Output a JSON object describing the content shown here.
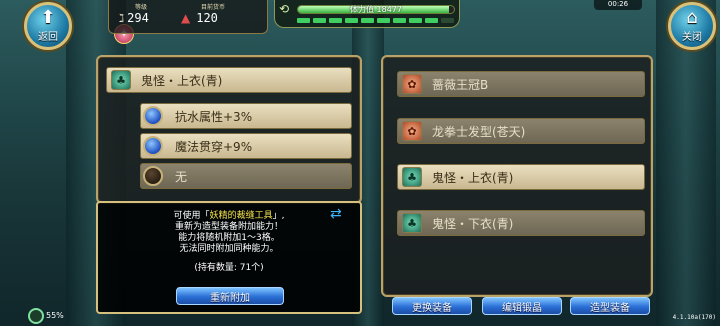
{
  "hud": {
    "back_label": "返回",
    "close_label": "关闭",
    "level_caption": "等级",
    "level_value": "294",
    "currency_caption": "目前货币",
    "currency_value": "120",
    "stamina_text": "体力值 18477",
    "stamina_fill_fraction": 0.97,
    "energy_segments_filled": 9,
    "energy_segments_total": 10,
    "clock": "00:26",
    "battery_percent": "55%",
    "version": "4.1.10a(170)"
  },
  "left_panel": {
    "item_name": "鬼怪・上衣(青)",
    "attributes": [
      {
        "label": "抗水属性+3%",
        "filled": true
      },
      {
        "label": "魔法贯穿+9%",
        "filled": true
      },
      {
        "label": "无",
        "filled": false
      }
    ]
  },
  "info_box": {
    "line1_prefix": "可使用「",
    "line1_highlight": "妖精的裁缝工具",
    "line1_suffix": "」,",
    "line2": "重新为造型装备附加能力！",
    "line3": "能力将随机附加1～3格。",
    "line4": "无法同时附加同种能力。",
    "owned": "(持有数量: 71个)",
    "reroll_button": "重新附加"
  },
  "right_panel": {
    "items": [
      {
        "name": "蔷薇王冠B",
        "icon": "red",
        "dimmed": true
      },
      {
        "name": "龙拳士发型(苍天)",
        "icon": "red",
        "dimmed": true
      },
      {
        "name": "鬼怪・上衣(青)",
        "icon": "green",
        "dimmed": false
      },
      {
        "name": "鬼怪・下衣(青)",
        "icon": "green",
        "dimmed": true
      }
    ]
  },
  "bottom_buttons": {
    "change_equip": "更换装备",
    "edit_crystal": "编辑锻晶",
    "style_equip": "造型装备"
  }
}
